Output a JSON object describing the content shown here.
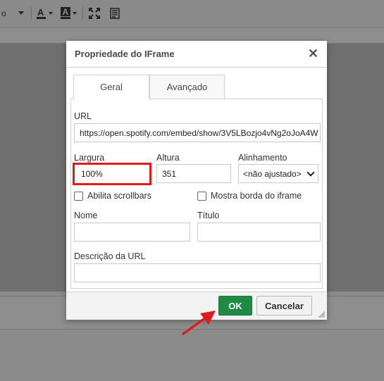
{
  "toolbar": {
    "partial_label": "o",
    "icons": [
      "dropdown-arrow-icon",
      "text-color-icon",
      "background-color-icon",
      "maximize-icon",
      "show-blocks-icon"
    ]
  },
  "dialog": {
    "title": "Propriedade do IFrame",
    "close_label": "✕",
    "tabs": [
      {
        "label": "Geral",
        "active": true
      },
      {
        "label": "Avançado",
        "active": false
      }
    ],
    "url": {
      "label": "URL",
      "value": "https://open.spotify.com/embed/show/3V5LBozjo4vNg2oJoA4W"
    },
    "width": {
      "label": "Largura",
      "value": "100%"
    },
    "height": {
      "label": "Altura",
      "value": "351"
    },
    "align": {
      "label": "Alinhamento",
      "value": "<não ajustado>"
    },
    "scrollbars": {
      "label": "Abilita scrollbars",
      "checked": false
    },
    "border": {
      "label": "Mostra borda do iframe",
      "checked": false
    },
    "name": {
      "label": "Nome",
      "value": ""
    },
    "title_field": {
      "label": "Título",
      "value": ""
    },
    "long_desc": {
      "label": "Descrição da URL",
      "value": ""
    },
    "ok_label": "OK",
    "cancel_label": "Cancelar"
  },
  "colors": {
    "ok_button": "#1e8a44",
    "highlight_border": "#e11b1b",
    "annotation_arrow": "#e11b1b"
  }
}
